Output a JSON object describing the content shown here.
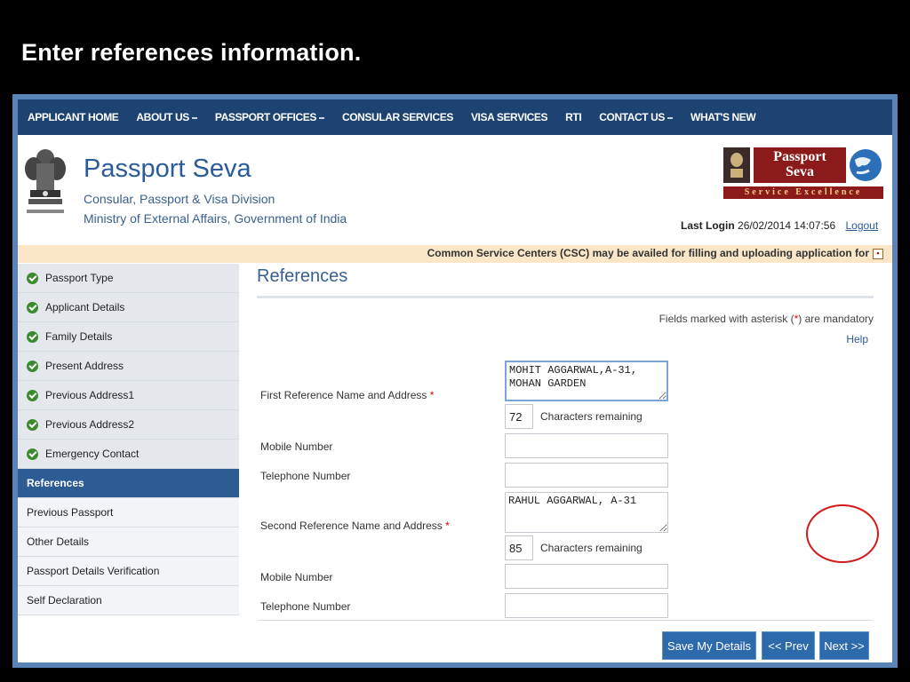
{
  "slide": {
    "title": "Enter references information."
  },
  "nav": {
    "items": [
      {
        "label": "APPLICANT HOME",
        "caret": false
      },
      {
        "label": "ABOUT US",
        "caret": true
      },
      {
        "label": "PASSPORT OFFICES",
        "caret": true
      },
      {
        "label": "CONSULAR SERVICES",
        "caret": false
      },
      {
        "label": "VISA SERVICES",
        "caret": false
      },
      {
        "label": "RTI",
        "caret": false
      },
      {
        "label": "CONTACT US",
        "caret": true
      },
      {
        "label": "WHAT'S NEW",
        "caret": false
      }
    ]
  },
  "header": {
    "title": "Passport Seva",
    "subtitle1": "Consular, Passport & Visa Division",
    "subtitle2": "Ministry of External Affairs, Government of India",
    "logo_line1": "Passport",
    "logo_line2": "Seva",
    "logo_tagline": "Service Excellence",
    "last_login_label": "Last Login",
    "last_login_value": "26/02/2014 14:07:56",
    "logout": "Logout"
  },
  "ticker": {
    "text": "Common Service Centers (CSC) may be availed for filling and uploading application for"
  },
  "sidebar": {
    "items": [
      {
        "label": "Passport Type",
        "state": "done"
      },
      {
        "label": "Applicant Details",
        "state": "done"
      },
      {
        "label": "Family Details",
        "state": "done"
      },
      {
        "label": "Present Address",
        "state": "done"
      },
      {
        "label": "Previous Address1",
        "state": "done"
      },
      {
        "label": "Previous Address2",
        "state": "done"
      },
      {
        "label": "Emergency Contact",
        "state": "done"
      },
      {
        "label": "References",
        "state": "active"
      },
      {
        "label": "Previous Passport",
        "state": "pending"
      },
      {
        "label": "Other Details",
        "state": "pending"
      },
      {
        "label": "Passport Details Verification",
        "state": "pending"
      },
      {
        "label": "Self Declaration",
        "state": "pending"
      }
    ]
  },
  "main": {
    "title": "References",
    "mandatory_pre": "Fields marked with asterisk (",
    "mandatory_star": "*",
    "mandatory_post": ") are mandatory",
    "help": "Help",
    "ref1_label": "First Reference Name and Address",
    "ref1_value": "MOHIT AGGARWAL,A-31,\nMOHAN GARDEN",
    "ref1_remaining": "72",
    "chars_remaining": "Characters remaining",
    "mobile_label": "Mobile Number",
    "telephone_label": "Telephone Number",
    "ref2_label": "Second Reference Name and Address",
    "ref2_value": "RAHUL AGGARWAL, A-31",
    "ref2_remaining": "85",
    "req_star": "*"
  },
  "buttons": {
    "save": "Save My Details",
    "prev": "<< Prev",
    "next": "Next >>"
  },
  "colors": {
    "nav_bg": "#1d4373",
    "active_item": "#2d5b93",
    "button": "#2d6aab",
    "annotation": "#d21a1a"
  }
}
